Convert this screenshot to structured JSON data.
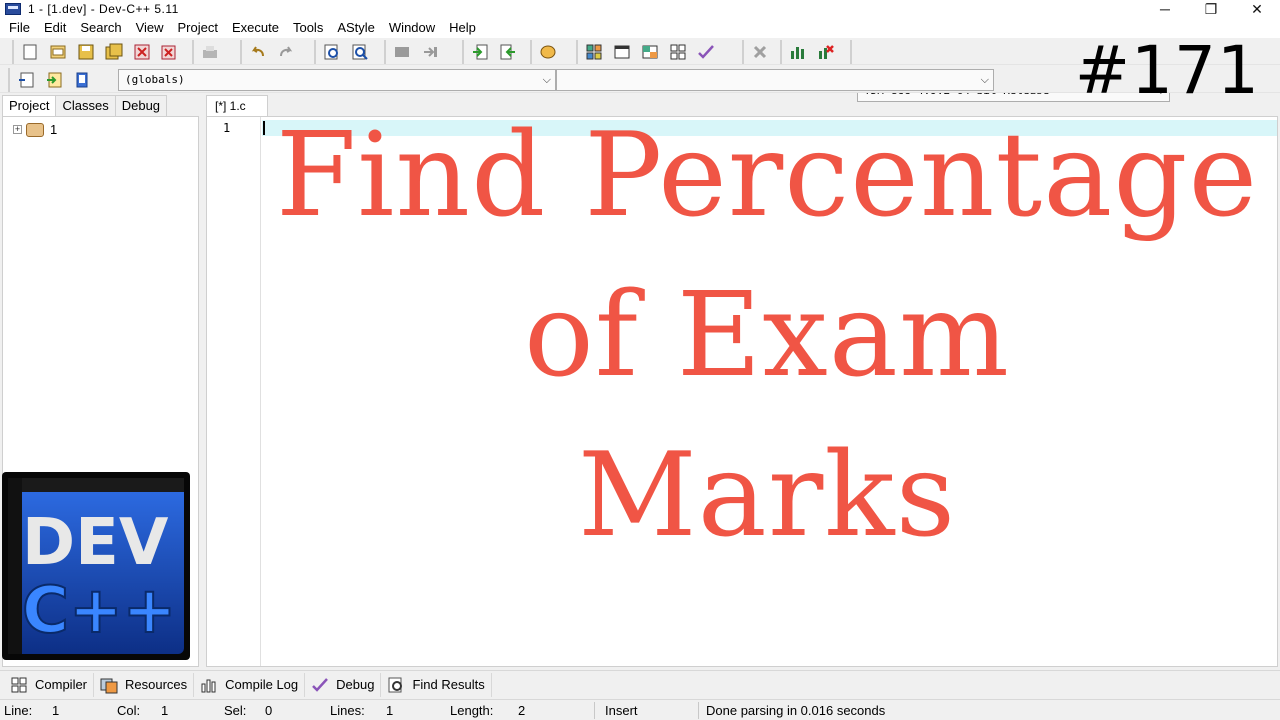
{
  "window": {
    "title": "1 - [1.dev] - Dev-C++ 5.11",
    "min": "─",
    "restore": "❐",
    "close": "✕"
  },
  "menu": [
    "File",
    "Edit",
    "Search",
    "View",
    "Project",
    "Execute",
    "Tools",
    "AStyle",
    "Window",
    "Help"
  ],
  "toolbar": {
    "compiler_select": "TDM-GCC 4.9.2 64-bit Release",
    "scope_select": "(globals)",
    "member_select": ""
  },
  "left_panel": {
    "tabs": [
      "Project",
      "Classes",
      "Debug"
    ],
    "tree_item": "1",
    "expander": "+"
  },
  "logo": {
    "line1": "DEV",
    "line2": "C++"
  },
  "editor": {
    "tab_label": "[*] 1.c",
    "line_number": "1",
    "badge": "#171",
    "title_lines": [
      "Find Percentage",
      "of Exam",
      "Marks"
    ]
  },
  "bottom_tabs": [
    "Compiler",
    "Resources",
    "Compile Log",
    "Debug",
    "Find Results"
  ],
  "status": {
    "line_label": "Line:",
    "line_value": "1",
    "col_label": "Col:",
    "col_value": "1",
    "sel_label": "Sel:",
    "sel_value": "0",
    "lines_label": "Lines:",
    "lines_value": "1",
    "length_label": "Length:",
    "length_value": "2",
    "mode": "Insert",
    "message": "Done parsing in 0.016 seconds"
  },
  "colors": {
    "title_accent": "#f05545",
    "current_line": "#d8f6f9",
    "logo_blue": "#1e5bd6"
  }
}
